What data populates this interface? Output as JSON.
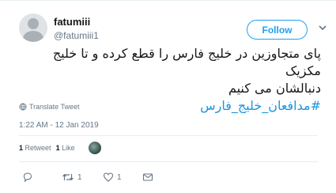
{
  "user": {
    "display_name": "fatumiii",
    "handle": "@fatumiii1"
  },
  "follow_button": {
    "label": "Follow"
  },
  "tweet": {
    "line1": "پای متجاوزین در خلیج فارس را قطع کرده و تا خلیج مکزیک",
    "line2": "دنبالشان می کنیم",
    "hashtag": "#مدافعان_خلیج_فارس",
    "translate_label": "Translate Tweet",
    "timestamp": "1:22 AM - 12 Jan 2019"
  },
  "stats": {
    "retweets_count": "1",
    "retweets_label": "Retweet",
    "likes_count": "1",
    "likes_label": "Like"
  },
  "actions": {
    "reply_count": "",
    "retweet_count": "1",
    "like_count": "1"
  },
  "colors": {
    "accent": "#1da1f2",
    "hashtag": "#1b95e0",
    "muted": "#657786"
  }
}
